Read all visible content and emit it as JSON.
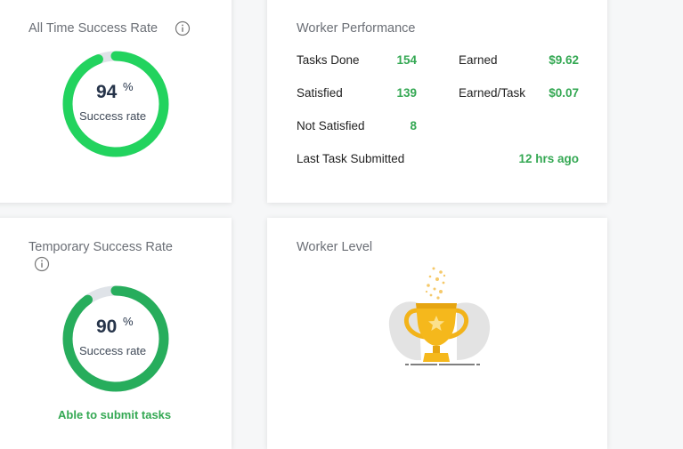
{
  "all_time": {
    "title": "All Time Success Rate",
    "value": "94",
    "unit": "%",
    "label": "Success rate",
    "progress": 0.94,
    "ring_color": "#22d35e"
  },
  "temporary": {
    "title": "Temporary Success Rate",
    "value": "90",
    "unit": "%",
    "label": "Success rate",
    "progress": 0.9,
    "ring_color": "#27ad5c",
    "status": "Able to submit tasks"
  },
  "performance": {
    "title": "Worker Performance",
    "tasks_done_label": "Tasks Done",
    "tasks_done_value": "154",
    "satisfied_label": "Satisfied",
    "satisfied_value": "139",
    "not_satisfied_label": "Not Satisfied",
    "not_satisfied_value": "8",
    "earned_label": "Earned",
    "earned_value": "$9.62",
    "earned_per_task_label": "Earned/Task",
    "earned_per_task_value": "$0.07",
    "last_task_label": "Last Task Submitted",
    "last_task_value": "12 hrs ago"
  },
  "level": {
    "title": "Worker Level",
    "icon": "trophy-icon"
  },
  "colors": {
    "accent_green": "#34a853",
    "ring_track": "#dfe3e8",
    "trophy_gold": "#f5b81c"
  }
}
